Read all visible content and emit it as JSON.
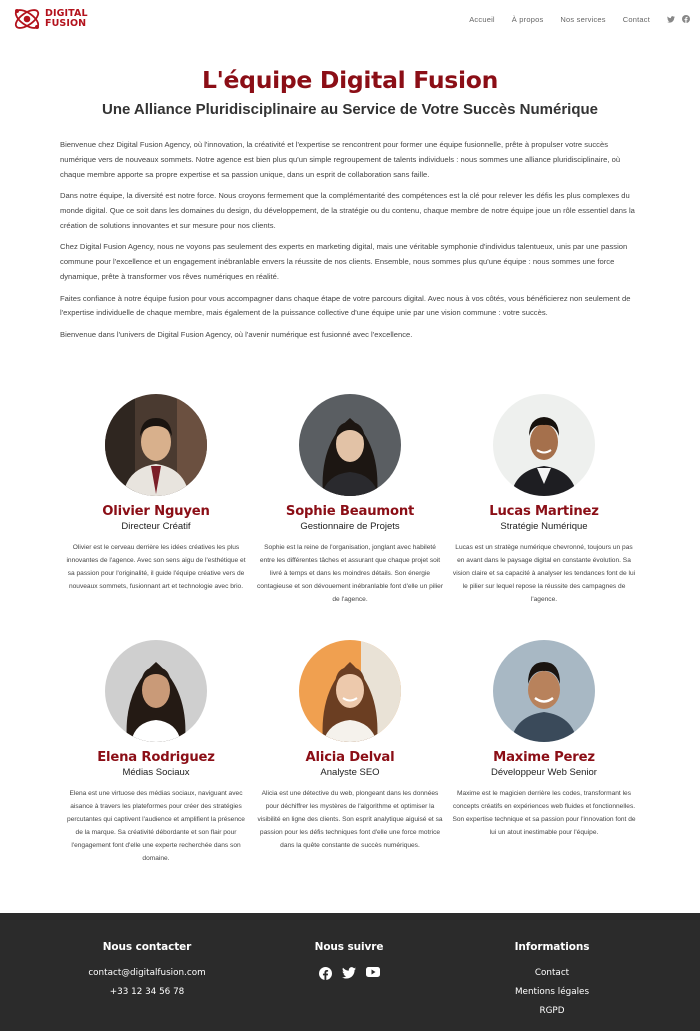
{
  "header": {
    "logo_line1": "DIGITAL",
    "logo_line2": "FUSION",
    "nav": [
      {
        "label": "Accueil"
      },
      {
        "label": "À propos"
      },
      {
        "label": "Nos services"
      },
      {
        "label": "Contact"
      }
    ],
    "social_icons": [
      "twitter-icon",
      "facebook-icon"
    ]
  },
  "hero": {
    "title": "L'équipe Digital Fusion",
    "subtitle": "Une Alliance Pluridisciplinaire au Service de Votre Succès Numérique"
  },
  "intro": [
    "Bienvenue chez Digital Fusion Agency, où l'innovation, la créativité et l'expertise se rencontrent pour former une équipe fusionnelle, prête à propulser votre succès numérique vers de nouveaux sommets. Notre agence est bien plus qu'un simple regroupement de talents individuels : nous sommes une alliance pluridisciplinaire, où chaque membre apporte sa propre expertise et sa passion unique, dans un esprit de collaboration sans faille.",
    "Dans notre équipe, la diversité est notre force. Nous croyons fermement que la complémentarité des compétences est la clé pour relever les défis les plus complexes du monde digital. Que ce soit dans les domaines du design, du développement, de la stratégie ou du contenu, chaque membre de notre équipe joue un rôle essentiel dans la création de solutions innovantes et sur mesure pour nos clients.",
    "Chez Digital Fusion Agency, nous ne voyons pas seulement des experts en marketing digital, mais une véritable symphonie d'individus talentueux, unis par une passion commune pour l'excellence et un engagement inébranlable envers la réussite de nos clients. Ensemble, nous sommes plus qu'une équipe : nous sommes une force dynamique, prête à transformer vos rêves numériques en réalité.",
    "Faites confiance à notre équipe fusion pour vous accompagner dans chaque étape de votre parcours digital. Avec nous à vos côtés, vous bénéficierez non seulement de l'expertise individuelle de chaque membre, mais également de la puissance collective d'une équipe unie par une vision commune : votre succès.",
    "Bienvenue dans l'univers de Digital Fusion Agency, où l'avenir numérique est fusionné avec l'excellence."
  ],
  "team": [
    {
      "name": "Olivier Nguyen",
      "role": "Directeur Créatif",
      "bio": "Olivier est le cerveau derrière les idées créatives les plus innovantes de l'agence. Avec son sens aigu de l'esthétique et sa passion pour l'originalité, il guide l'équipe créative vers de nouveaux sommets, fusionnant art et technologie avec brio."
    },
    {
      "name": "Sophie Beaumont",
      "role": "Gestionnaire de Projets",
      "bio": "Sophie est la reine de l'organisation, jonglant avec habileté entre les différentes tâches et assurant que chaque projet soit livré à temps et dans les moindres détails. Son énergie contagieuse et son dévouement inébranlable font d'elle un pilier de l'agence."
    },
    {
      "name": "Lucas Martinez",
      "role": "Stratégie Numérique",
      "bio": "Lucas est un stratège numérique chevronné, toujours un pas en avant dans le paysage digital en constante évolution. Sa vision claire et sa capacité à analyser les tendances font de lui le pilier sur lequel repose la réussite des campagnes de l'agence."
    },
    {
      "name": "Elena Rodriguez",
      "role": "Médias Sociaux",
      "bio": "Elena est une virtuose des médias sociaux, naviguant avec aisance à travers les plateformes pour créer des stratégies percutantes qui captivent l'audience et amplifient la présence de la marque. Sa créativité débordante et son flair pour l'engagement font d'elle une experte recherchée dans son domaine."
    },
    {
      "name": "Alicia Delval",
      "role": "Analyste SEO",
      "bio": "Alicia est une détective du web, plongeant dans les données pour déchiffrer les mystères de l'algorithme et optimiser la visibilité en ligne des clients. Son esprit analytique aiguisé et sa passion pour les défis techniques font d'elle une force motrice dans la quête constante de succès numériques."
    },
    {
      "name": "Maxime Perez",
      "role": "Développeur Web Senior",
      "bio": "Maxime est le magicien derrière les codes, transformant les concepts créatifs en expériences web fluides et fonctionnelles. Son expertise technique et sa passion pour l'innovation font de lui un atout inestimable pour l'équipe."
    }
  ],
  "footer": {
    "contact": {
      "title": "Nous contacter",
      "email": "contact@digitalfusion.com",
      "phone": "+33 12 34 56 78"
    },
    "follow": {
      "title": "Nous suivre",
      "icons": [
        "facebook-icon",
        "twitter-icon",
        "youtube-icon"
      ]
    },
    "info": {
      "title": "Informations",
      "links": [
        "Contact",
        "Mentions légales",
        "RGPD"
      ]
    }
  },
  "colors": {
    "brand_red": "#b3121c",
    "heading_red": "#8b0e16",
    "footer_bg": "#2b2b2b"
  }
}
